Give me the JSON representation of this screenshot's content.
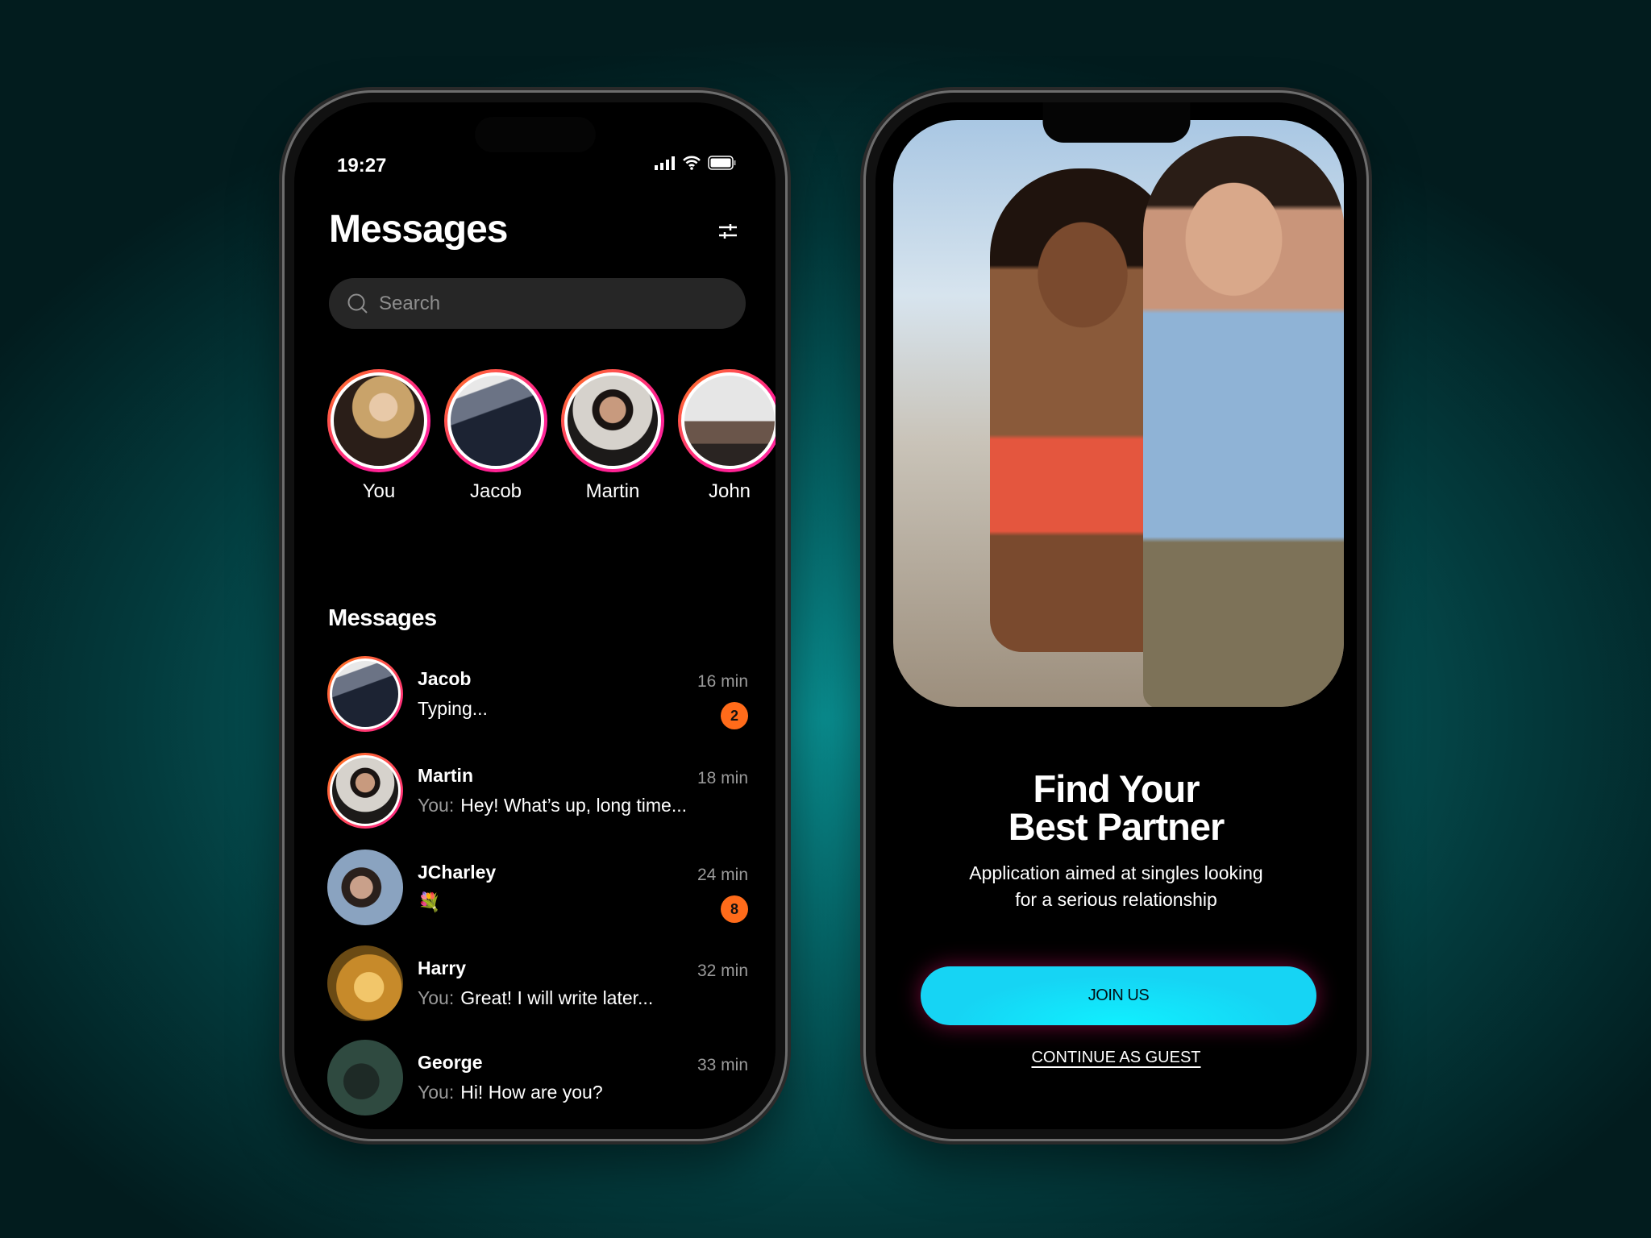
{
  "messages_screen": {
    "status_bar": {
      "time": "19:27"
    },
    "title": "Messages",
    "search": {
      "placeholder": "Search"
    },
    "stories": [
      {
        "name": "You"
      },
      {
        "name": "Jacob"
      },
      {
        "name": "Martin"
      },
      {
        "name": "John"
      }
    ],
    "section_title": "Messages",
    "conversations": [
      {
        "name": "Jacob",
        "prefix": "",
        "preview": "Typing...",
        "time": "16 min",
        "unread": "2"
      },
      {
        "name": "Martin",
        "prefix": "You:",
        "preview": "Hey! What’s up, long time...",
        "time": "18 min",
        "unread": ""
      },
      {
        "name": "JCharley",
        "prefix": "",
        "preview": "💐",
        "time": "24 min",
        "unread": "8"
      },
      {
        "name": "Harry",
        "prefix": "You:",
        "preview": "Great! I will write later...",
        "time": "32 min",
        "unread": ""
      },
      {
        "name": "George",
        "prefix": "You:",
        "preview": "Hi! How are you?",
        "time": "33 min",
        "unread": ""
      }
    ],
    "nav": {
      "icons": [
        "home-icon",
        "heart-smile-icon",
        "heart-icon",
        "chat-icon",
        "profile-icon"
      ],
      "active": "chat-icon"
    }
  },
  "welcome_screen": {
    "headline_line1": "Find Your",
    "headline_line2": "Best Partner",
    "description_line1": "Application aimed at singles looking",
    "description_line2": "for a serious relationship",
    "join_label": "JOIN US",
    "guest_label": "CONTINUE AS GUEST"
  },
  "colors": {
    "accent_pink": "#ff1f8e",
    "accent_orange": "#ff6b1a",
    "button_cyan": "#16d4f4"
  }
}
